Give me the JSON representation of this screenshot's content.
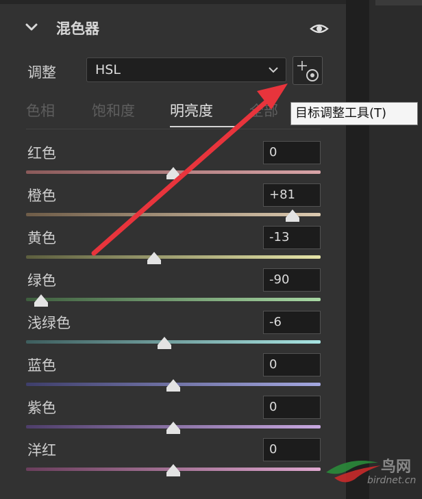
{
  "panel": {
    "title": "混色器",
    "adjust_label": "调整",
    "adjust_value": "HSL",
    "tooltip": "目标调整工具(T)"
  },
  "tabs": [
    {
      "label": "色相",
      "active": false
    },
    {
      "label": "饱和度",
      "active": false
    },
    {
      "label": "明亮度",
      "active": true
    },
    {
      "label": "全部",
      "active": false
    }
  ],
  "sliders": [
    {
      "label": "红色",
      "value": "0",
      "fraction": 0.5,
      "gradient": [
        "#8a5a5a",
        "#d9a5a8"
      ]
    },
    {
      "label": "橙色",
      "value": "+81",
      "fraction": 0.905,
      "gradient": [
        "#6e5c48",
        "#dccab0"
      ]
    },
    {
      "label": "黄色",
      "value": "-13",
      "fraction": 0.435,
      "gradient": [
        "#5c5e3e",
        "#e6e4a8"
      ]
    },
    {
      "label": "绿色",
      "value": "-90",
      "fraction": 0.05,
      "gradient": [
        "#3e5e3e",
        "#a8d8a4"
      ]
    },
    {
      "label": "浅绿色",
      "value": "-6",
      "fraction": 0.47,
      "gradient": [
        "#3e5e5e",
        "#a8e4e2"
      ]
    },
    {
      "label": "蓝色",
      "value": "0",
      "fraction": 0.5,
      "gradient": [
        "#3e3e6a",
        "#a4a8e0"
      ]
    },
    {
      "label": "紫色",
      "value": "0",
      "fraction": 0.5,
      "gradient": [
        "#4e3e6a",
        "#c8a8e0"
      ]
    },
    {
      "label": "洋红",
      "value": "0",
      "fraction": 0.5,
      "gradient": [
        "#6a3e5c",
        "#e0a8d0"
      ]
    }
  ],
  "watermark": {
    "cn": "鸟网",
    "en": "birdnet.cn"
  },
  "colors": {
    "arrow": "#e8343c",
    "accent_text": "#e2e2e2"
  },
  "icons": [
    "chevron-down-icon",
    "eye-icon",
    "dropdown-chevron-icon",
    "target-adjust-icon"
  ]
}
